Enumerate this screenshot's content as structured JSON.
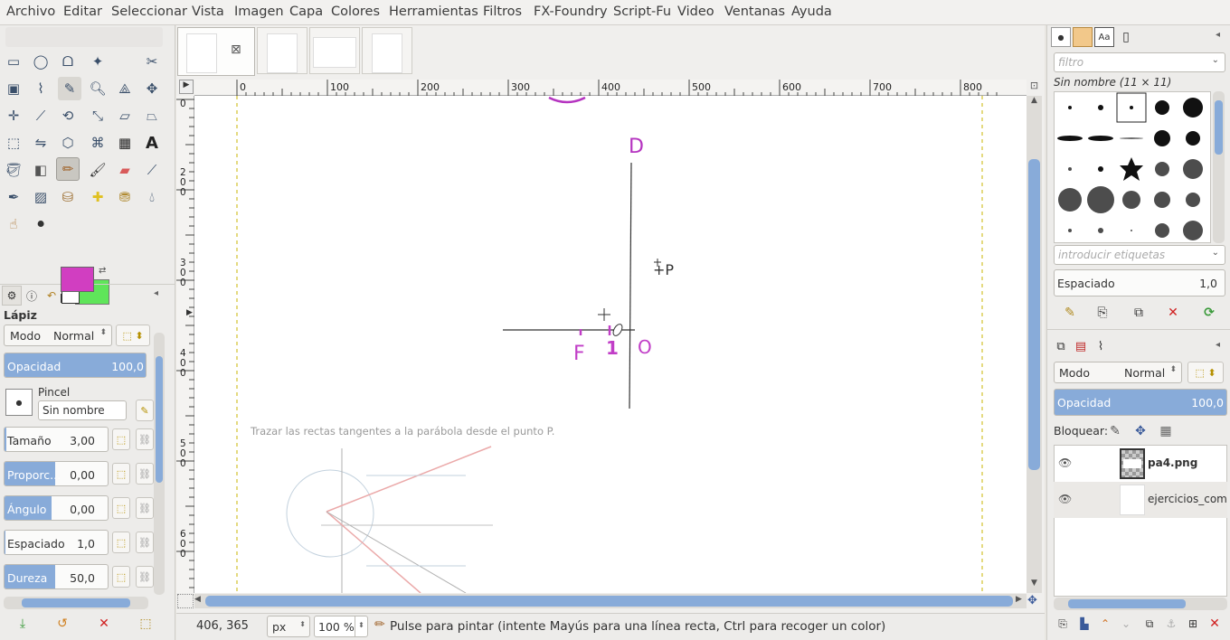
{
  "menu": [
    "Archivo",
    "Editar",
    "Seleccionar",
    "Vista",
    "Imagen",
    "Capa",
    "Colores",
    "Herramientas",
    "Filtros",
    "FX-Foundry",
    "Script-Fu",
    "Video",
    "Ventanas",
    "Ayuda"
  ],
  "tool_options": {
    "title": "Lápiz",
    "mode_label": "Modo",
    "mode_value": "Normal",
    "opacity_label": "Opacidad",
    "opacity_value": "100,0",
    "opacity_level": 1.0,
    "brush_label": "Pincel",
    "brush_name": "Sin nombre",
    "size_label": "Tamaño",
    "size_value": "3,00",
    "ratio_label": "Proporc...",
    "ratio_value": "0,00",
    "angle_label": "Ángulo",
    "angle_value": "0,00",
    "spacing_label": "Espaciado",
    "spacing_value": "1,0",
    "hardness_label": "Dureza",
    "hardness_value": "50,0"
  },
  "colors": {
    "foreground": "#d13ec1",
    "background": "#5fe55a"
  },
  "ruler_labels": [
    "0",
    "100",
    "200",
    "300",
    "400",
    "500",
    "600",
    "700",
    "800"
  ],
  "vruler_labels": [
    "0",
    "2\n0\n0",
    "3\n0\n0",
    "4\n0\n0",
    "5\n0\n0",
    "6\n0\n0"
  ],
  "canvas_text": {
    "label_d": "D",
    "label_p": "+P",
    "label_f": "F",
    "label_one": "1",
    "label_o": "O",
    "exercise_text": "Trazar las rectas tangentes a la parábola desde el punto P."
  },
  "status": {
    "coords": "406, 365",
    "unit": "px",
    "zoom": "100 %",
    "message": "Pulse para pintar (intente Mayús para una línea recta, Ctrl para recoger un color)"
  },
  "brushes": {
    "filter_placeholder": "filtro",
    "brush_title": "Sin nombre (11 × 11)",
    "tags_placeholder": "introducir etiquetas",
    "spacing_label": "Espaciado",
    "spacing_value": "1,0"
  },
  "layers": {
    "mode_label": "Modo",
    "mode_value": "Normal",
    "opacity_label": "Opacidad",
    "opacity_value": "100,0",
    "lock_label": "Bloquear:",
    "items": [
      {
        "name": "pa4.png"
      },
      {
        "name": "ejercicios_comp"
      }
    ]
  }
}
